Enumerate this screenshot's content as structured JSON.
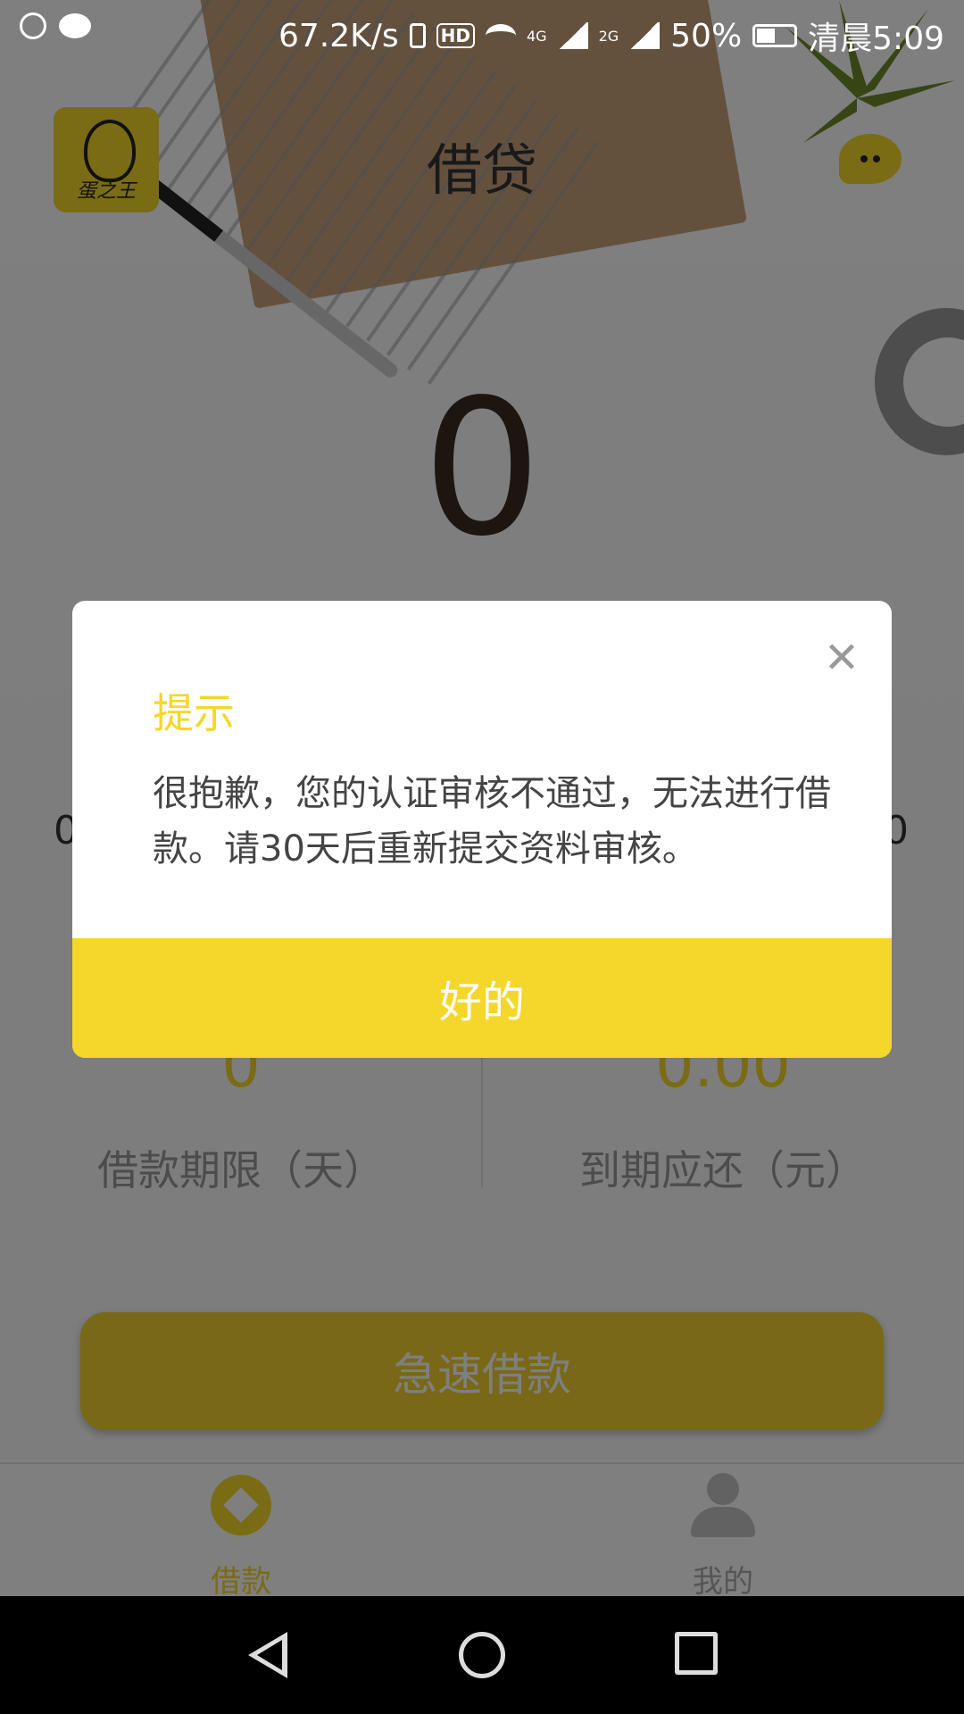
{
  "status_bar": {
    "net_speed": "67.2K/s",
    "hd": "HD",
    "network_4g": "4G",
    "network_2g": "2G",
    "battery": "50%",
    "time": "清晨5:09"
  },
  "header": {
    "title": "借贷",
    "logo_text": "蛋之王"
  },
  "loan": {
    "amount": "0",
    "min_label": "0",
    "max_label": "0"
  },
  "info": {
    "term_value": "0",
    "term_label": "借款期限（天）",
    "due_value": "0.00",
    "due_label": "到期应还（元）"
  },
  "action": {
    "loan_button": "急速借款"
  },
  "tabs": [
    {
      "label": "借款",
      "icon": "diamond-icon",
      "active": true
    },
    {
      "label": "我的",
      "icon": "user-icon",
      "active": false
    }
  ],
  "modal": {
    "title": "提示",
    "message": "很抱歉，您的认证审核不通过，无法进行借款。请30天后重新提交资料审核。",
    "ok_button": "好的",
    "close_icon": "close-icon"
  },
  "colors": {
    "accent": "#f5d62a",
    "overlay": "rgba(0,0,0,0.5)"
  }
}
